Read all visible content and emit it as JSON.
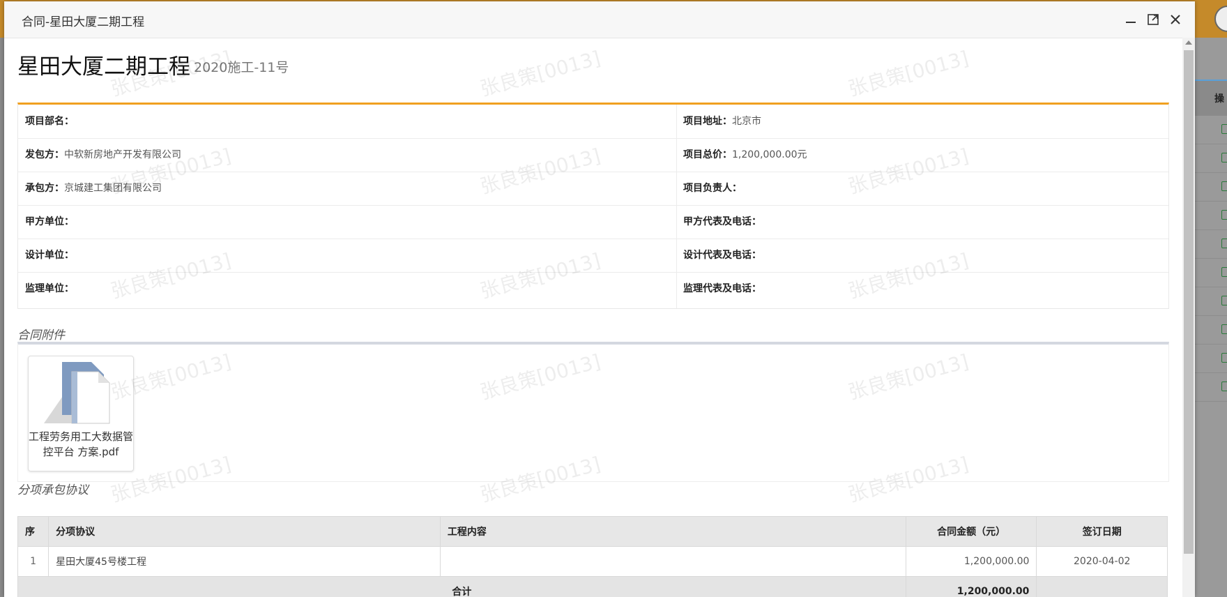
{
  "modal": {
    "title": "合同-星田大厦二期工程"
  },
  "project": {
    "name": "星田大厦二期工程",
    "code": "2020施工-11号"
  },
  "info": {
    "rows": [
      {
        "left_label": "项目部名：",
        "left_value": "",
        "right_label": "项目地址：",
        "right_value": "北京市"
      },
      {
        "left_label": "发包方：",
        "left_value": "中软新房地产开发有限公司",
        "right_label": "项目总价：",
        "right_value": "1,200,000.00元"
      },
      {
        "left_label": "承包方：",
        "left_value": "京城建工集团有限公司",
        "right_label": "项目负责人：",
        "right_value": ""
      },
      {
        "left_label": "甲方单位：",
        "left_value": "",
        "right_label": "甲方代表及电话：",
        "right_value": ""
      },
      {
        "left_label": "设计单位：",
        "left_value": "",
        "right_label": "设计代表及电话：",
        "right_value": ""
      },
      {
        "left_label": "监理单位：",
        "left_value": "",
        "right_label": "监理代表及电话：",
        "right_value": ""
      }
    ]
  },
  "attachments": {
    "section_title": "合同附件",
    "files": [
      {
        "name": "工程劳务用工大数据管控平台 方案.pdf",
        "icon": "pdf-file-icon"
      }
    ]
  },
  "subcontracts": {
    "section_title": "分项承包协议",
    "columns": [
      "序",
      "分项协议",
      "工程内容",
      "合同金额（元）",
      "签订日期"
    ],
    "rows": [
      {
        "no": "1",
        "name": "星田大厦45号楼工程",
        "content": "",
        "amount": "1,200,000.00",
        "date": "2020-04-02"
      }
    ],
    "total_label": "合计",
    "total_amount": "1,200,000.00"
  },
  "watermark": "张良策[0013]",
  "background": {
    "column_header": "操"
  },
  "colors": {
    "accent": "#f0a020",
    "topbar": "#c58a2a"
  }
}
